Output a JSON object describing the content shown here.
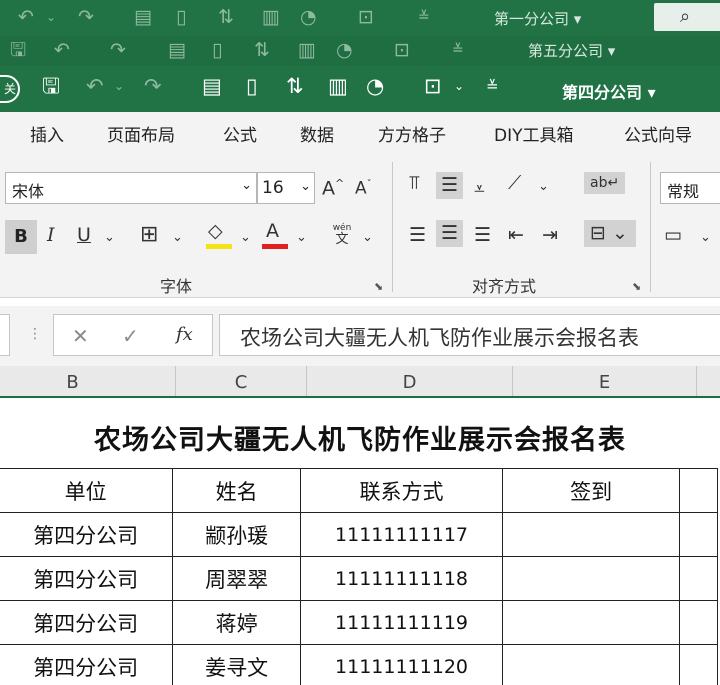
{
  "ghost_windows": [
    {
      "title": "第一分公司 ▾"
    },
    {
      "title": "第五分公司 ▾"
    }
  ],
  "window": {
    "title": "第四分公司 ▾",
    "close_label": "关"
  },
  "ribbon_tabs": [
    "插入",
    "页面布局",
    "公式",
    "数据",
    "方方格子",
    "DIY工具箱",
    "公式向导"
  ],
  "font": {
    "name": "宋体",
    "size": "16",
    "group_label": "字体",
    "wen_label": "wén",
    "wen_char": "文"
  },
  "alignment": {
    "group_label": "对齐方式"
  },
  "number": {
    "format": "常规"
  },
  "formula_bar": {
    "content": "农场公司大疆无人机飞防作业展示会报名表",
    "cancel": "✕",
    "confirm": "✓",
    "fx": "fx"
  },
  "columns": [
    "B",
    "C",
    "D",
    "E"
  ],
  "sheet": {
    "title": "农场公司大疆无人机飞防作业展示会报名表",
    "headers": [
      "单位",
      "姓名",
      "联系方式",
      "签到"
    ],
    "rows": [
      {
        "unit": "第四分公司",
        "name": "颛孙瑗",
        "phone": "11111111117",
        "sign": ""
      },
      {
        "unit": "第四分公司",
        "name": "周翠翠",
        "phone": "11111111118",
        "sign": ""
      },
      {
        "unit": "第四分公司",
        "name": "蒋婷",
        "phone": "11111111119",
        "sign": ""
      },
      {
        "unit": "第四分公司",
        "name": "姜寻文",
        "phone": "11111111120",
        "sign": ""
      }
    ]
  },
  "colors": {
    "excel_green": "#217346",
    "selected_button": "#d2d2d2",
    "fill_yellow": "#f5e31a",
    "font_red": "#e02020"
  }
}
